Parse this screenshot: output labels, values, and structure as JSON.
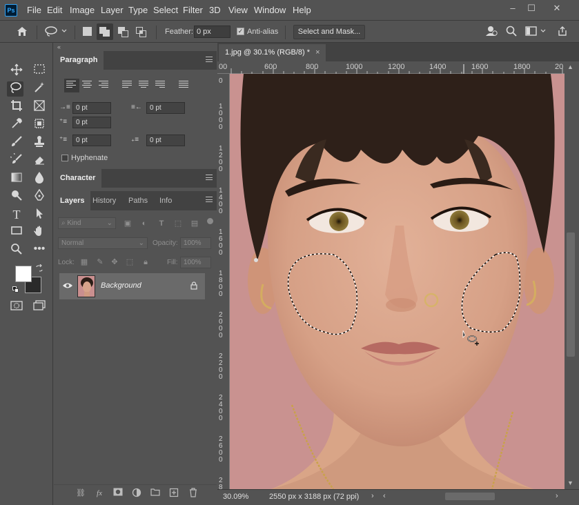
{
  "app": {
    "logo": "Ps"
  },
  "menubar": {
    "items": [
      "File",
      "Edit",
      "Image",
      "Layer",
      "Type",
      "Select",
      "Filter",
      "3D",
      "View",
      "Window",
      "Help"
    ],
    "window_controls": {
      "minimize": "–",
      "maximize": "☐",
      "close": "✕"
    }
  },
  "options": {
    "feather_label": "Feather:",
    "feather_value": "0 px",
    "antialias_label": "Anti-alias",
    "antialias_checked": true,
    "select_mask_label": "Select and Mask..."
  },
  "panels": {
    "collapse": "«",
    "paragraph": {
      "title": "Paragraph",
      "fields": [
        "0 pt",
        "0 pt",
        "0 pt",
        "0 pt",
        "0 pt"
      ],
      "hyphenate_label": "Hyphenate"
    },
    "character": {
      "title": "Character"
    },
    "layers": {
      "tabs": [
        "Layers",
        "History",
        "Paths",
        "Info"
      ],
      "filter_kind": "Kind",
      "blend_mode": "Normal",
      "opacity_label": "Opacity:",
      "opacity_value": "100%",
      "lock_label": "Lock:",
      "fill_label": "Fill:",
      "fill_value": "100%",
      "layer_name": "Background"
    }
  },
  "document": {
    "tab_title": "1.jpg @ 30.1% (RGB/8) *",
    "tab_close": "×",
    "ruler_top": [
      "00",
      "600",
      "800",
      "1000",
      "1200",
      "1400",
      "1600",
      "1800",
      "20"
    ],
    "ruler_left": [
      "0",
      "1\n0\n0\n0",
      "1\n2\n0\n0",
      "1\n4\n0\n0",
      "1\n6\n0\n0",
      "1\n8\n0\n0",
      "2\n0\n0\n0",
      "2\n2\n0\n0",
      "2\n4\n0\n0",
      "2\n6\n0\n0",
      "2\n8"
    ],
    "zoom": "30.09%",
    "info": "2550 px x 3188 px (72 ppi)"
  },
  "colors": {
    "ui_bg": "#535353",
    "dark": "#424242",
    "accent": "#31a8ff",
    "skin": "#d9a58c",
    "backdrop": "#c9908e"
  }
}
